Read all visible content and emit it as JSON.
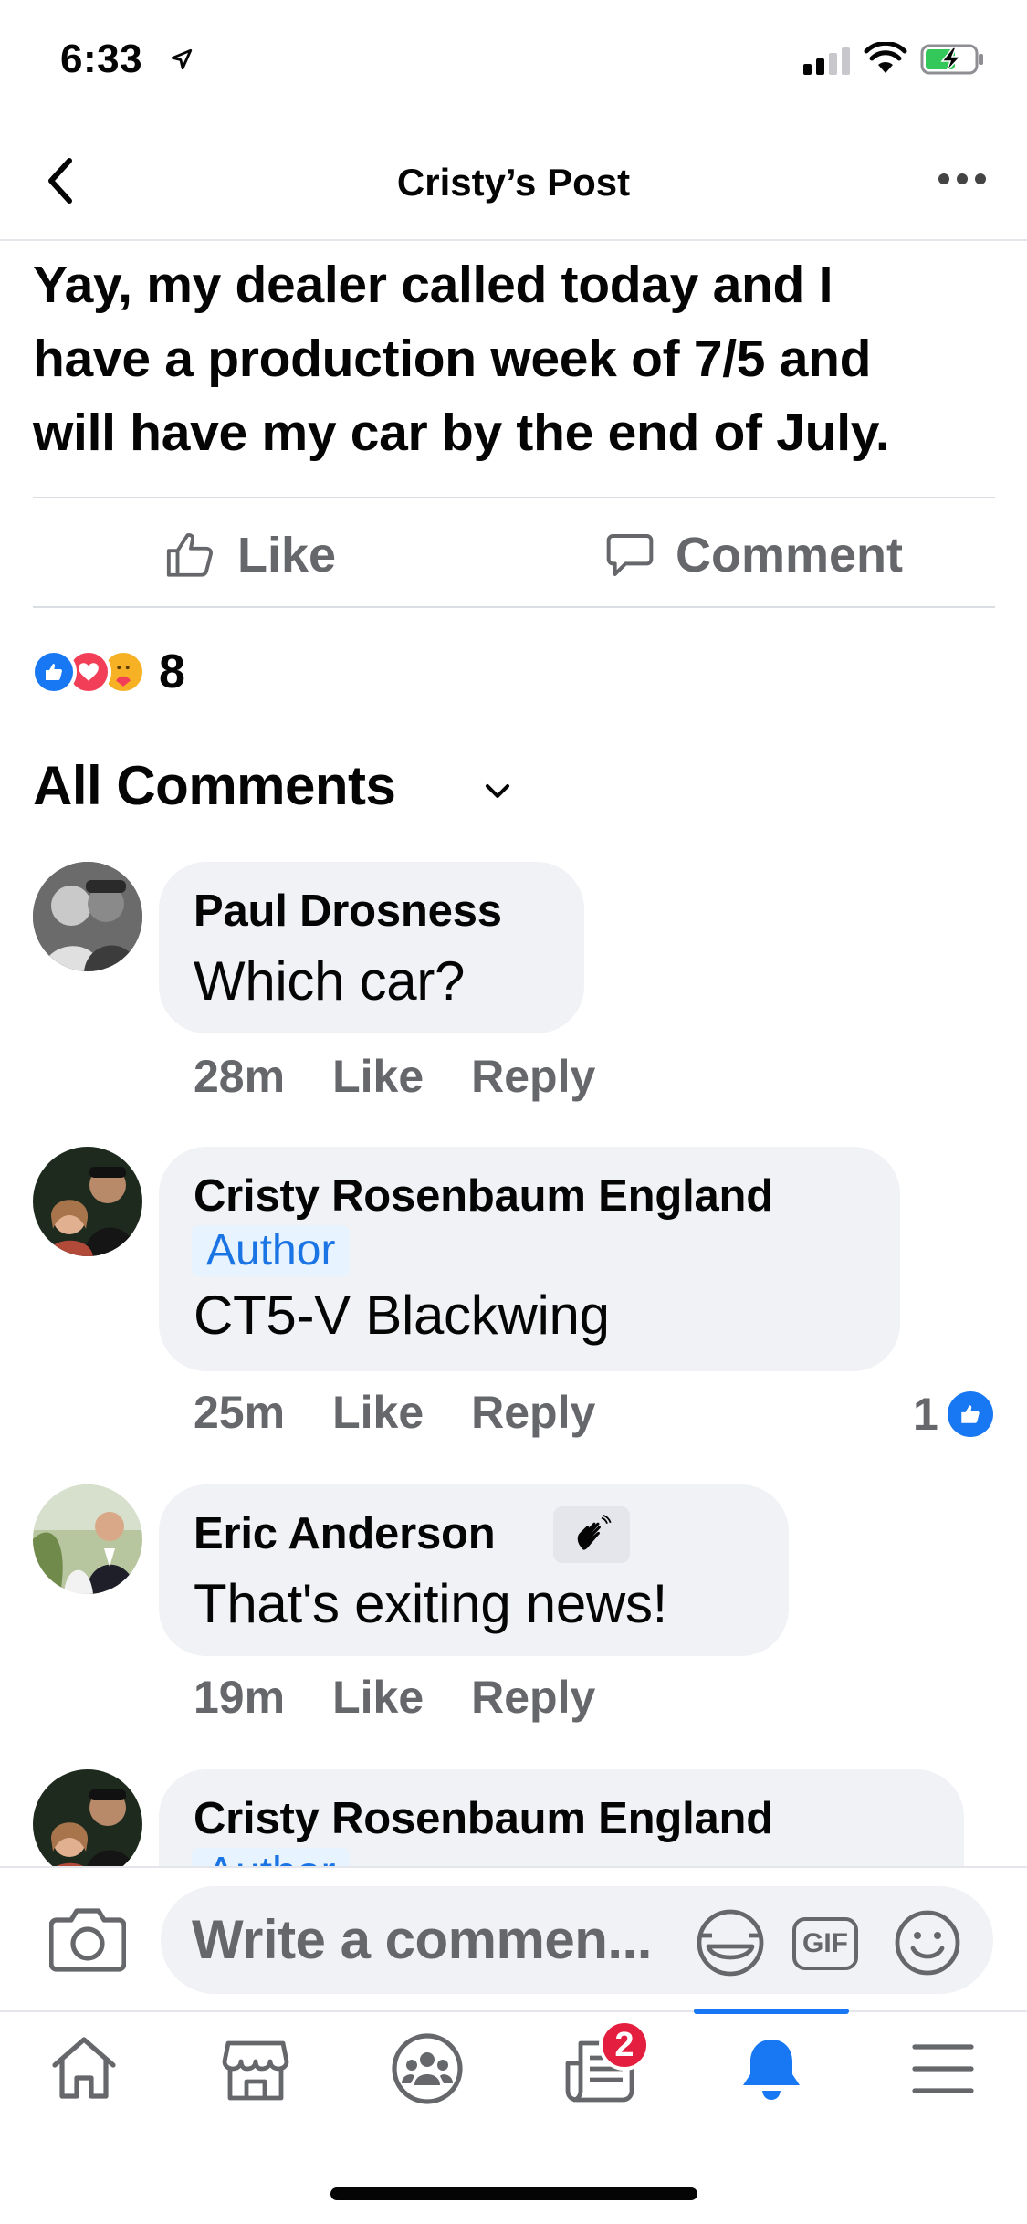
{
  "status_bar": {
    "time": "6:33"
  },
  "header": {
    "title": "Cristy’s Post"
  },
  "post": {
    "lines": [
      "Yay, my dealer called today and I",
      "have a production week of 7/5 and",
      "will have my car by the end of July."
    ]
  },
  "actions": {
    "like_label": "Like",
    "comment_label": "Comment"
  },
  "reactions": {
    "count": "8",
    "types": [
      "like-icon",
      "love-icon",
      "care-icon"
    ]
  },
  "comments_header": {
    "label": "All Comments"
  },
  "comments": [
    {
      "name": "Paul Drosness",
      "text": "Which car?",
      "time": "28m",
      "like": "Like",
      "reply": "Reply"
    },
    {
      "name": "Cristy Rosenbaum England",
      "badge": "Author",
      "text": "CT5-V Blackwing",
      "time": "25m",
      "like": "Like",
      "reply": "Reply",
      "reaction_count": "1"
    },
    {
      "name": "Eric Anderson",
      "text": "That's exiting news!",
      "time": "19m",
      "like": "Like",
      "reply": "Reply"
    },
    {
      "name": "Cristy Rosenbaum England",
      "badge": "Author"
    }
  ],
  "composer": {
    "placeholder": "Write a commen...",
    "gif_label": "GIF"
  },
  "tabbar": {
    "items": [
      "home-icon",
      "marketplace-icon",
      "groups-icon",
      "news-icon",
      "notifications-icon",
      "menu-icon"
    ],
    "news_badge": "2",
    "active": "notifications-icon"
  },
  "colors": {
    "accent": "#1877f2",
    "secondary_text": "#65676b",
    "bubble": "#f0f2f5",
    "badge": "#e41e3f"
  }
}
